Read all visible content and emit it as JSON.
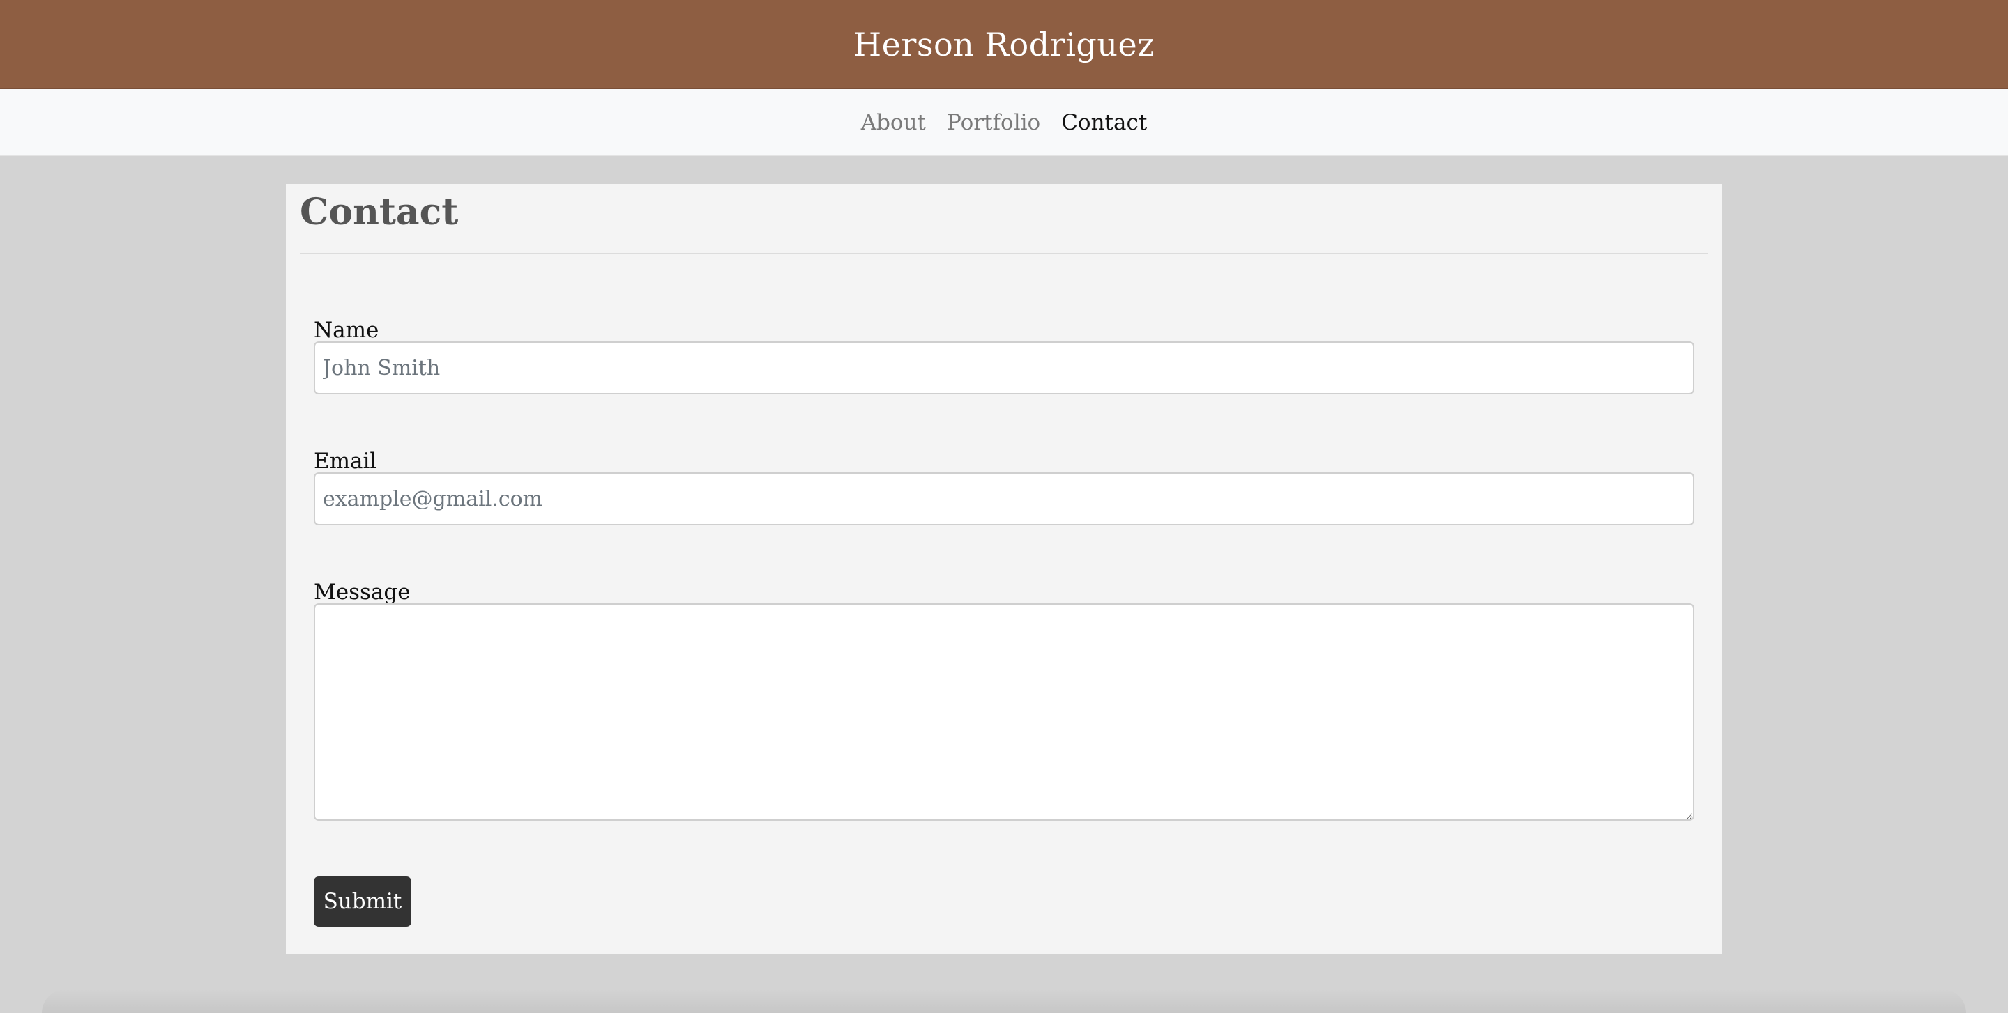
{
  "header": {
    "title": "Herson Rodriguez"
  },
  "nav": {
    "items": [
      {
        "label": "About",
        "active": false
      },
      {
        "label": "Portfolio",
        "active": false
      },
      {
        "label": "Contact",
        "active": true
      }
    ]
  },
  "main": {
    "title": "Contact",
    "form": {
      "name": {
        "label": "Name",
        "value": "",
        "placeholder": "John Smith"
      },
      "email": {
        "label": "Email",
        "value": "",
        "placeholder": "example@gmail.com"
      },
      "message": {
        "label": "Message",
        "value": ""
      },
      "submit_label": "Submit"
    }
  },
  "colors": {
    "header_bg": "#8e5e42",
    "nav_bg": "#f8f9fa",
    "page_bg": "#d3d3d3",
    "card_bg": "#f4f4f4",
    "button_bg": "#333333"
  }
}
